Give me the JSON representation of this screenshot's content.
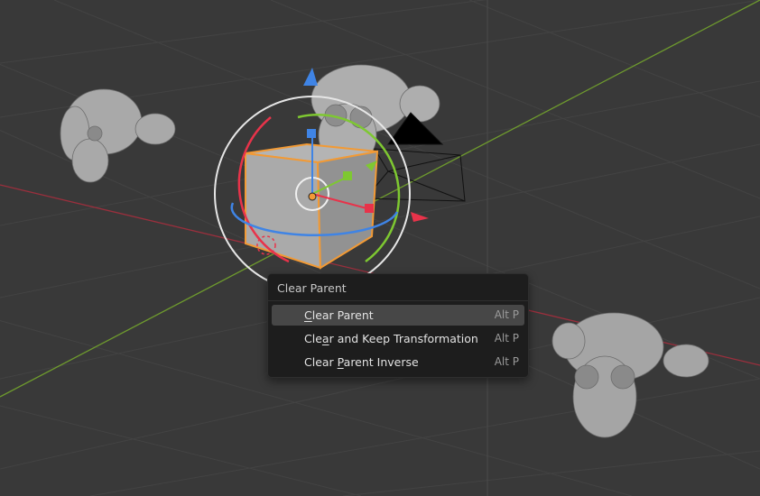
{
  "viewport": {
    "description_colors": {
      "background": "#393939",
      "grid_line": "#444444",
      "x_axis": "#9b2f3d",
      "y_axis": "#6e9a2e",
      "selection_outline": "#f29a35",
      "gizmo_x": "#e8334a",
      "gizmo_y": "#7ec831",
      "gizmo_z": "#3f84e5"
    },
    "objects": [
      "cube-selected",
      "monkey-left",
      "monkey-center",
      "monkey-right",
      "camera"
    ]
  },
  "context_menu": {
    "title": "Clear Parent",
    "items": [
      {
        "pre": "",
        "key": "C",
        "post": "lear Parent",
        "shortcut": "Alt P",
        "active": true
      },
      {
        "pre": "Cle",
        "key": "a",
        "post": "r and Keep Transformation",
        "shortcut": "Alt P",
        "active": false
      },
      {
        "pre": "Clear ",
        "key": "P",
        "post": "arent Inverse",
        "shortcut": "Alt P",
        "active": false
      }
    ]
  }
}
